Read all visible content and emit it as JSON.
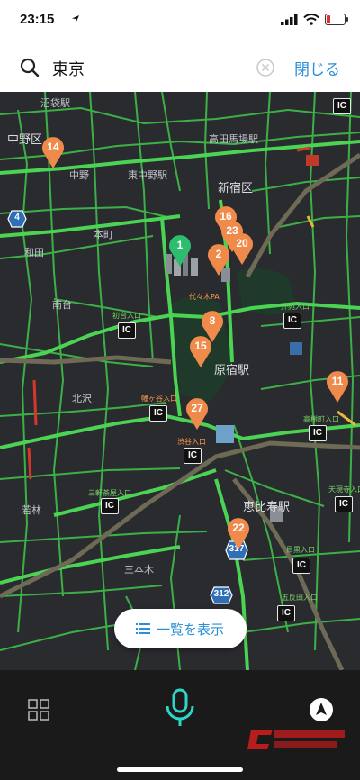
{
  "status": {
    "time": "23:15"
  },
  "search": {
    "query": "東京",
    "close_label": "閉じる"
  },
  "map": {
    "labels": [
      "沼袋駅",
      "中野区",
      "高田馬場駅",
      "東中野駅",
      "新宿区",
      "中野",
      "本町",
      "和田",
      "南台",
      "初台入口",
      "代々木PA",
      "外苑入口",
      "原宿駅",
      "幡ヶ谷入口",
      "北沢",
      "渋谷入口",
      "高樹町入口",
      "三軒茶屋入口",
      "天現寺入口",
      "恵比寿駅",
      "若林",
      "目黒入口",
      "五反田入口",
      "三本木"
    ],
    "pins": [
      {
        "label": "1",
        "color": "#2dbd6e"
      },
      {
        "label": "2",
        "color": "#f08a4b"
      },
      {
        "label": "8",
        "color": "#f08a4b"
      },
      {
        "label": "11",
        "color": "#f08a4b"
      },
      {
        "label": "14",
        "color": "#f08a4b"
      },
      {
        "label": "15",
        "color": "#f08a4b"
      },
      {
        "label": "16",
        "color": "#f08a4b"
      },
      {
        "label": "20",
        "color": "#f08a4b"
      },
      {
        "label": "22",
        "color": "#f08a4b"
      },
      {
        "label": "23",
        "color": "#f08a4b"
      },
      {
        "label": "27",
        "color": "#f08a4b"
      }
    ],
    "ic_label": "IC",
    "route_shields": [
      "4",
      "317",
      "312"
    ],
    "list_button_label": "一覧を表示"
  },
  "bottom": {
    "icons": [
      "grid-icon",
      "microphone-icon",
      "compass-icon"
    ]
  },
  "colors": {
    "accent": "#2a8fd6",
    "road": "#3fbf4a",
    "pin_orange": "#f08a4b",
    "pin_green": "#2dbd6e",
    "map_bg": "#2a2b2f"
  }
}
